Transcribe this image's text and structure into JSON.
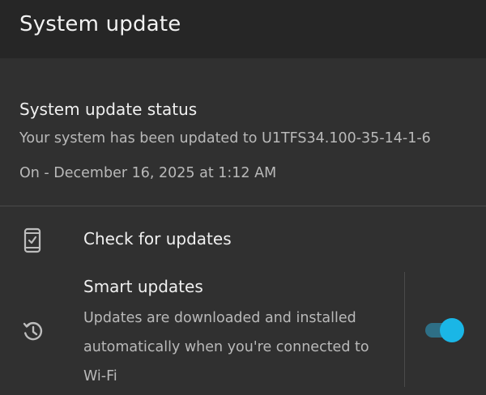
{
  "header": {
    "title": "System update"
  },
  "status": {
    "title": "System update status",
    "message": "Your system has been updated to U1TFS34.100-35-14-1-6",
    "date": "On - December 16, 2025 at 1:12 AM"
  },
  "check_updates": {
    "label": "Check for updates",
    "icon": "phone-check-icon"
  },
  "smart_updates": {
    "title": "Smart updates",
    "description": "Updates are downloaded and installed automatically when you're connected to Wi-Fi",
    "icon": "history-icon",
    "enabled": true
  },
  "colors": {
    "background": "#303030",
    "header_background": "#262626",
    "accent": "#1ab6e6",
    "toggle_track": "#2e6f86"
  }
}
